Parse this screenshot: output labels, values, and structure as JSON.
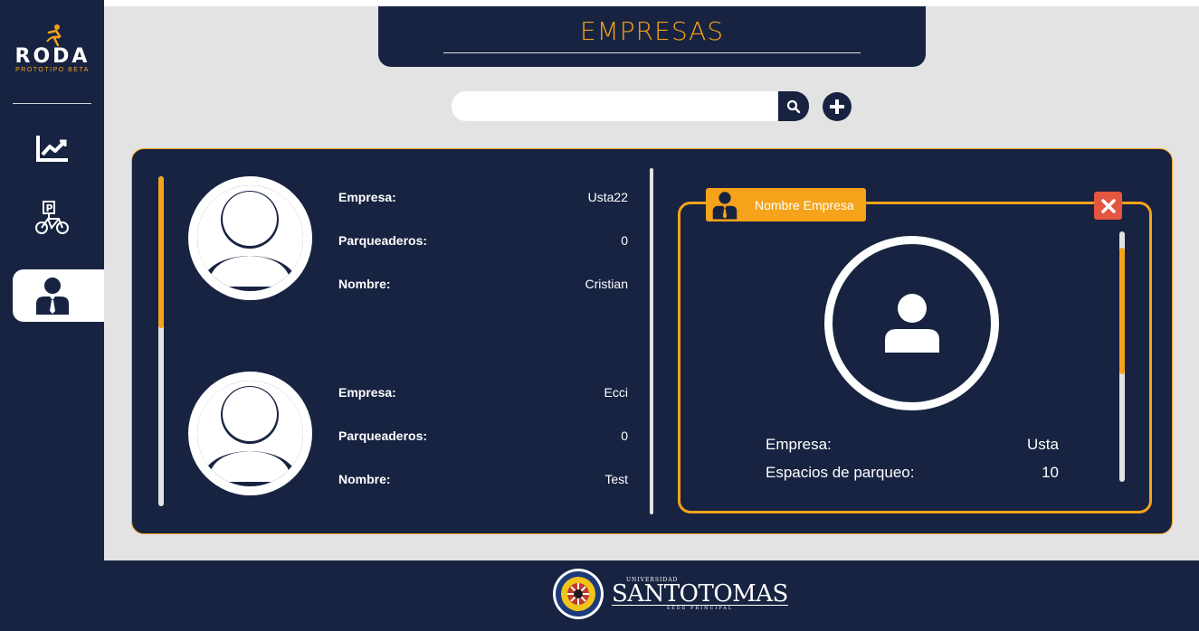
{
  "app": {
    "logo_text": "RODA",
    "logo_subtitle": "PROTOTIPO BETA"
  },
  "header": {
    "title": "EMPRESAS"
  },
  "search": {
    "value": "",
    "placeholder": ""
  },
  "sidebar": {
    "items": [
      {
        "icon": "chart-icon",
        "label": "Estadisticas"
      },
      {
        "icon": "parking-bike-icon",
        "label": "Parqueaderos"
      },
      {
        "icon": "business-user-icon",
        "label": "Empresas",
        "active": true
      }
    ],
    "logout_icon": "door-exit-icon"
  },
  "list": {
    "cards": [
      {
        "empresa_label": "Empresa:",
        "empresa_value": "Usta22",
        "parqueaderos_label": "Parqueaderos:",
        "parqueaderos_value": "0",
        "nombre_label": "Nombre:",
        "nombre_value": "Cristian"
      },
      {
        "empresa_label": "Empresa:",
        "empresa_value": "Ecci",
        "parqueaderos_label": "Parqueaderos:",
        "parqueaderos_value": "0",
        "nombre_label": "Nombre:",
        "nombre_value": "Test"
      }
    ]
  },
  "detail": {
    "tag_label": "Nombre Empresa",
    "empresa_label": "Empresa:",
    "empresa_value": "Usta",
    "espacios_label": "Espacios de parqueo:",
    "espacios_value": "10"
  },
  "footer": {
    "univ_small": "UNIVERSIDAD",
    "univ_name": "SANTOTOMAS",
    "univ_sede": "SEDE PRINCIPAL"
  },
  "colors": {
    "navy": "#172341",
    "accent": "#f5a31a",
    "close": "#e4563f",
    "background": "#e3e3e3"
  }
}
